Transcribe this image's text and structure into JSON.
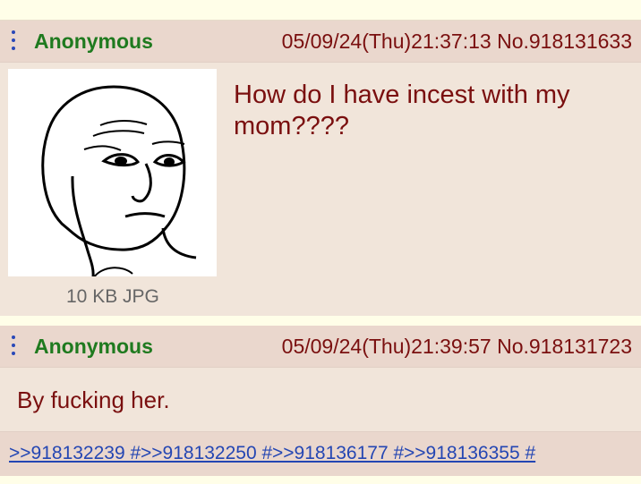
{
  "posts": [
    {
      "name": "Anonymous",
      "datetime": "05/09/24(Thu)21:37:13",
      "number": "No.918131633",
      "comment": "How do I have incest with my mom????",
      "file_info": "10 KB JPG",
      "image_icon": "wojak-face-drawing"
    },
    {
      "name": "Anonymous",
      "datetime": "05/09/24(Thu)21:39:57",
      "number": "No.918131723",
      "comment": "By fucking her.",
      "replies": [
        ">>918132239 #",
        ">>918132250 #",
        ">>918136177 #",
        ">>918136355 #"
      ]
    }
  ],
  "colors": {
    "name": "#1f7a1f",
    "meta": "#7a0f0f",
    "comment": "#7a0f0f",
    "link": "#2446b3",
    "post_bg": "#f1e5da",
    "header_bg": "#ead7cd",
    "page_bg": "#fffee8"
  }
}
